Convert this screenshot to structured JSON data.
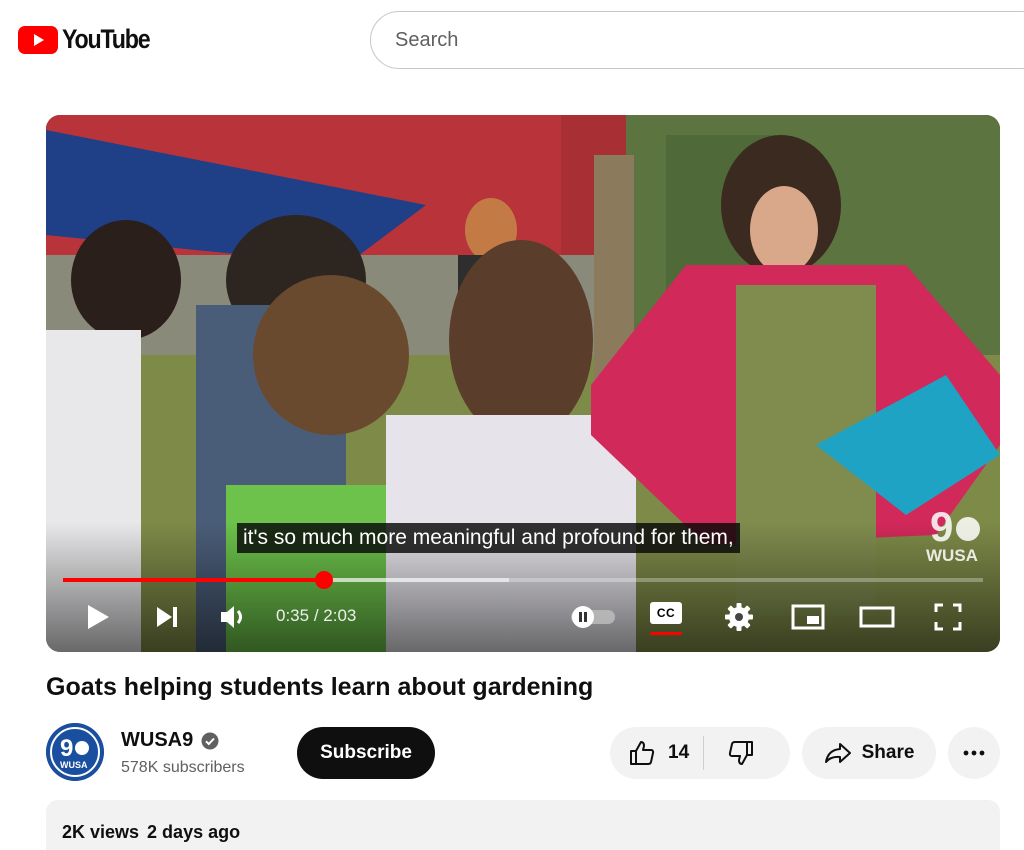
{
  "header": {
    "logo_text": "YouTube",
    "search_placeholder": "Search"
  },
  "player": {
    "caption": "it's so much more meaningful and profound for them,",
    "current_time": "0:35",
    "time_separator": " / ",
    "duration": "2:03",
    "played_fraction": 0.284,
    "buffered_fraction": 0.485,
    "watermark_line1": "9",
    "watermark_line2": "WUSA",
    "captions_label": "CC"
  },
  "video": {
    "title": "Goats helping students learn about gardening"
  },
  "channel": {
    "name": "WUSA9",
    "subscribers": "578K subscribers",
    "avatar_text": "WUSA"
  },
  "actions": {
    "subscribe_label": "Subscribe",
    "like_count": "14",
    "share_label": "Share"
  },
  "description": {
    "views": "2K views",
    "date": "2 days ago"
  },
  "colors": {
    "brand_red": "#ff0000",
    "text_primary": "#0f0f0f",
    "text_secondary": "#606060",
    "pill_bg": "#f2f2f2"
  }
}
